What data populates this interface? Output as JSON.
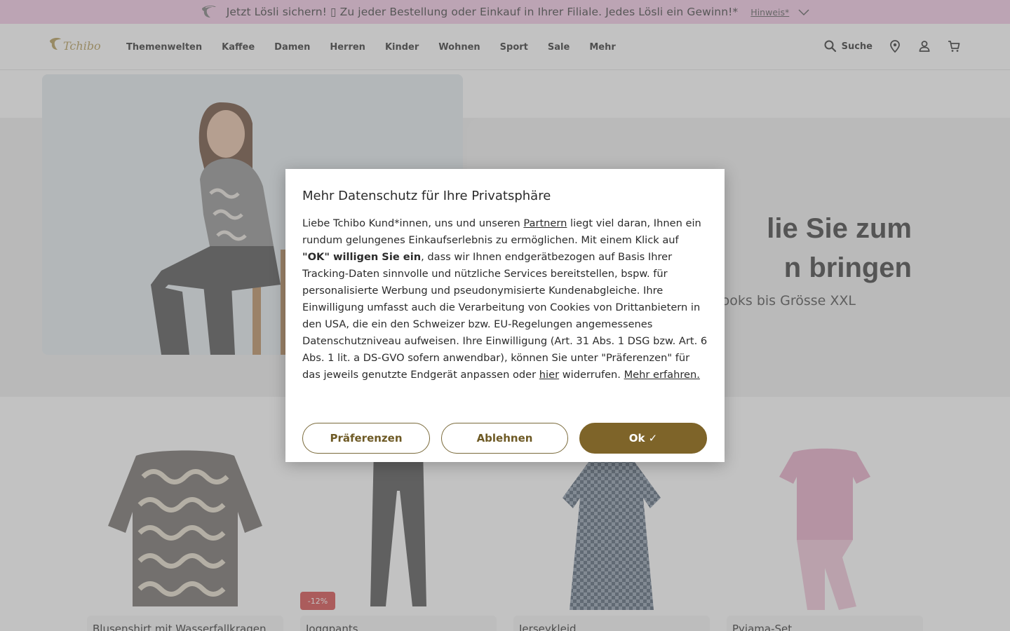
{
  "promo": {
    "text": "Jetzt Lösli sichern! ▯ Zu jeder Bestellung oder Einkauf in Ihrer Filiale. Jedes Lösli ein Gewinn!*",
    "link": "Hinweis*"
  },
  "header": {
    "brand": "Tchibo",
    "nav": [
      "Themenwelten",
      "Kaffee",
      "Damen",
      "Herren",
      "Kinder",
      "Wohnen",
      "Sport",
      "Sale",
      "Mehr"
    ],
    "search_label": "Suche"
  },
  "hero": {
    "title_line1": "lie Sie zum",
    "title_line2": "n bringen",
    "subtitle": "ooks bis Grösse XXL"
  },
  "products": [
    {
      "name": "Blusenshirt mit Wasserfallkragen",
      "badge": ""
    },
    {
      "name": "Joggpants",
      "badge": "-12%"
    },
    {
      "name": "Jerseykleid",
      "badge": ""
    },
    {
      "name": "Pyjama-Set",
      "badge": ""
    }
  ],
  "consent": {
    "title": "Mehr Datenschutz für Ihre Privatsphäre",
    "p1_a": "Liebe Tchibo Kund*innen, uns und unseren ",
    "p1_link_partners": "Partnern",
    "p1_b": " liegt viel daran, Ihnen ein rundum gelungenes Einkaufserlebnis zu ermöglichen. Mit einem Klick auf ",
    "p1_bold": "\"OK\" willigen Sie ein",
    "p1_c": ", dass wir Ihnen endgerätbezogen auf Basis Ihrer Tracking-Daten sinnvolle und nützliche Services bereitstellen, bspw. für personalisierte Werbung und pseudonymisierte Kundenabgleiche. Ihre Einwilligung umfasst auch die Verarbeitung von Cookies von Drittanbietern in den USA, die ein den Schweizer bzw. EU-Regelungen angemessenes Datenschutzniveau aufweisen. Ihre Einwilligung (Art. 31 Abs. 1 DSG bzw. Art. 6 Abs. 1 lit. a DS-GVO sofern anwendbar), können Sie unter \"Präferenzen\" für das jeweils genutzte Endgerät anpassen oder ",
    "p1_link_here": "hier",
    "p1_d": " widerrufen. ",
    "p1_link_more": "Mehr erfahren.",
    "btn_prefs": "Präferenzen",
    "btn_decline": "Ablehnen",
    "btn_ok": "Ok ✓"
  }
}
